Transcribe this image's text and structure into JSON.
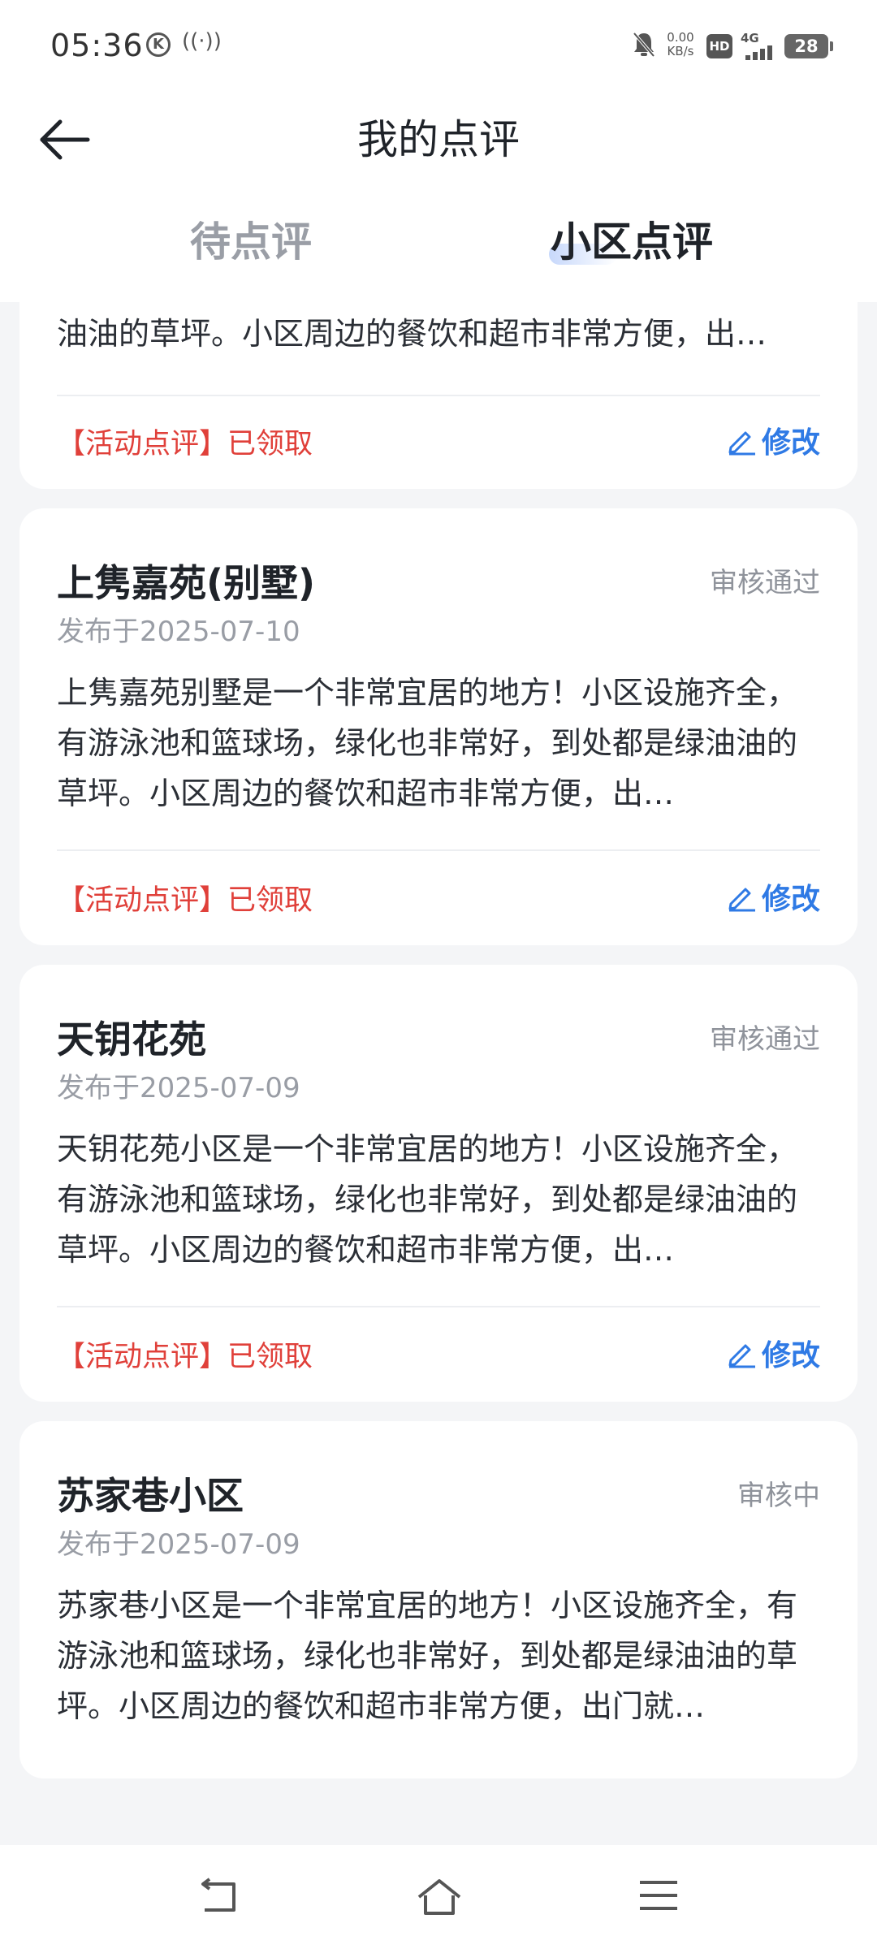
{
  "status_bar": {
    "time": "05:36",
    "k_badge": "K",
    "speed_top": "0.00",
    "speed_bottom": "KB/s",
    "hd": "HD",
    "network": "4G",
    "battery": "28"
  },
  "nav": {
    "title": "我的点评"
  },
  "tabs": [
    {
      "label": "待点评",
      "active": false
    },
    {
      "label": "小区点评",
      "active": true
    }
  ],
  "colors": {
    "accent": "#2f7ae5",
    "tag": "#e0403a",
    "tab_highlight": "#c7d8fb"
  },
  "cards": [
    {
      "body_tail": "油油的草坪。小区周边的餐饮和超市非常方便，出…",
      "tag": "【活动点评】已领取",
      "edit": "修改"
    },
    {
      "name": "上隽嘉苑(别墅)",
      "status": "审核通过",
      "date": "发布于2025-07-10",
      "body": "上隽嘉苑别墅是一个非常宜居的地方！小区设施齐全，有游泳池和篮球场，绿化也非常好，到处都是绿油油的草坪。小区周边的餐饮和超市非常方便，出…",
      "tag": "【活动点评】已领取",
      "edit": "修改"
    },
    {
      "name": "天钥花苑",
      "status": "审核通过",
      "date": "发布于2025-07-09",
      "body": "天钥花苑小区是一个非常宜居的地方！小区设施齐全，有游泳池和篮球场，绿化也非常好，到处都是绿油油的草坪。小区周边的餐饮和超市非常方便，出…",
      "tag": "【活动点评】已领取",
      "edit": "修改"
    },
    {
      "name": "苏家巷小区",
      "status": "审核中",
      "date": "发布于2025-07-09",
      "body": "苏家巷小区是一个非常宜居的地方！小区设施齐全，有游泳池和篮球场，绿化也非常好，到处都是绿油油的草坪。小区周边的餐饮和超市非常方便，出门就…"
    }
  ],
  "system_nav": {
    "icons": [
      "back-icon",
      "home-icon",
      "menu-icon"
    ]
  }
}
